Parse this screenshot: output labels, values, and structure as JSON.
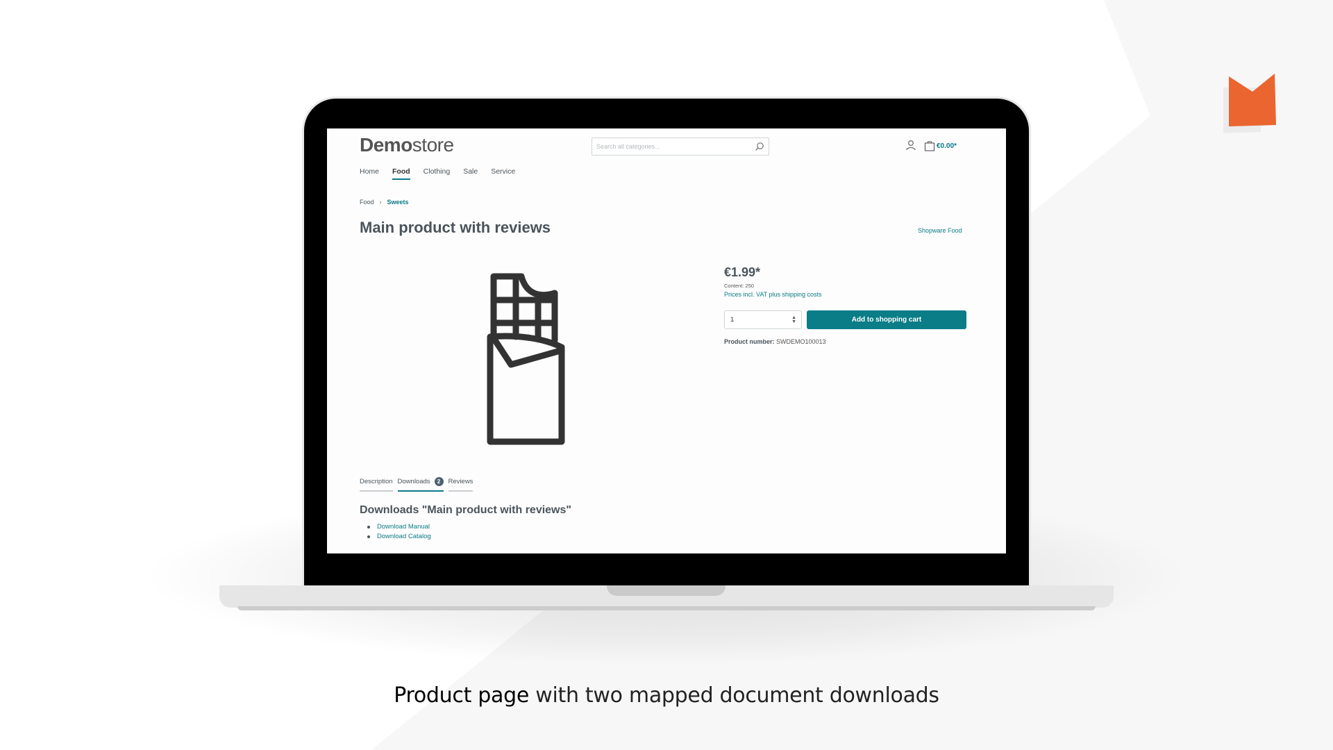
{
  "colors": {
    "accent": "#0b7a86",
    "button": "#0b7d87",
    "brand_orange": "#ea6530",
    "text": "#4a545b",
    "badge": "#4d6173"
  },
  "store": {
    "logo_bold": "Demo",
    "logo_light": "store",
    "search_placeholder": "Search all categories...",
    "search_icon": "search-icon",
    "account_icon": "user-icon",
    "cart_icon": "shopping-bag-icon",
    "cart_total": "€0.00*"
  },
  "nav": {
    "items": [
      {
        "label": "Home",
        "active": false
      },
      {
        "label": "Food",
        "active": true
      },
      {
        "label": "Clothing",
        "active": false
      },
      {
        "label": "Sale",
        "active": false
      },
      {
        "label": "Service",
        "active": false
      }
    ]
  },
  "breadcrumb": {
    "items": [
      "Food",
      "Sweets"
    ],
    "separator": "›"
  },
  "product": {
    "title": "Main product with reviews",
    "manufacturer": "Shopware Food",
    "image_icon": "chocolate-bar-icon",
    "price": "€1.99*",
    "content": "Content: 250",
    "vat_note": "Prices incl. VAT plus shipping costs",
    "quantity": "1",
    "add_to_cart": "Add to shopping cart",
    "product_number_label": "Product number:",
    "product_number": "SWDEMO100013"
  },
  "tabs": [
    {
      "label": "Description",
      "active": false
    },
    {
      "label": "Downloads",
      "active": true,
      "badge": "2"
    },
    {
      "label": "Reviews",
      "active": false
    }
  ],
  "downloads": {
    "heading": "Downloads \"Main product with reviews\"",
    "items": [
      "Download Manual",
      "Download Catalog"
    ]
  },
  "caption": {
    "strong": "Product page",
    "rest": " with two mapped document downloads"
  }
}
